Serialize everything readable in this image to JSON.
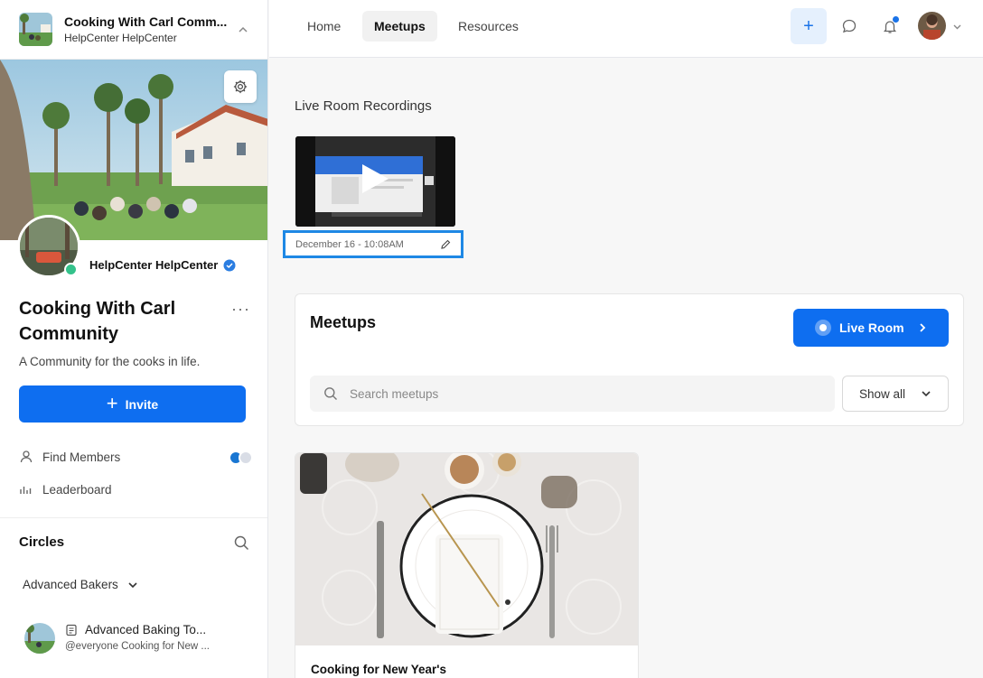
{
  "community": {
    "name": "Cooking With Carl Comm...",
    "subtitle": "HelpCenter HelpCenter",
    "owner": "HelpCenter HelpCenter",
    "full_title": "Cooking With Carl Community",
    "description": "A Community for the cooks in life.",
    "invite_label": "Invite",
    "more_label": "···"
  },
  "sidebar": {
    "nav": [
      {
        "label": "Find Members",
        "icon": "person-icon"
      },
      {
        "label": "Leaderboard",
        "icon": "bar-chart-icon"
      }
    ],
    "circles_title": "Circles",
    "circle_group": "Advanced Bakers",
    "circle_item": {
      "name": "Advanced Baking To...",
      "message": "@everyone Cooking for New ..."
    }
  },
  "topbar": {
    "tabs": [
      "Home",
      "Meetups",
      "Resources"
    ],
    "active_tab": "Meetups",
    "plus_label": "+"
  },
  "recordings": {
    "title": "Live Room Recordings",
    "items": [
      {
        "label": "December 16 - 10:08AM"
      }
    ]
  },
  "meetups": {
    "title": "Meetups",
    "live_room_label": "Live Room",
    "search_placeholder": "Search meetups",
    "filter_label": "Show all",
    "cards": [
      {
        "title": "Cooking for New Year's"
      }
    ]
  },
  "colors": {
    "primary": "#0e6ef0",
    "online": "#34c28b",
    "highlight_border": "#1e88e5"
  }
}
